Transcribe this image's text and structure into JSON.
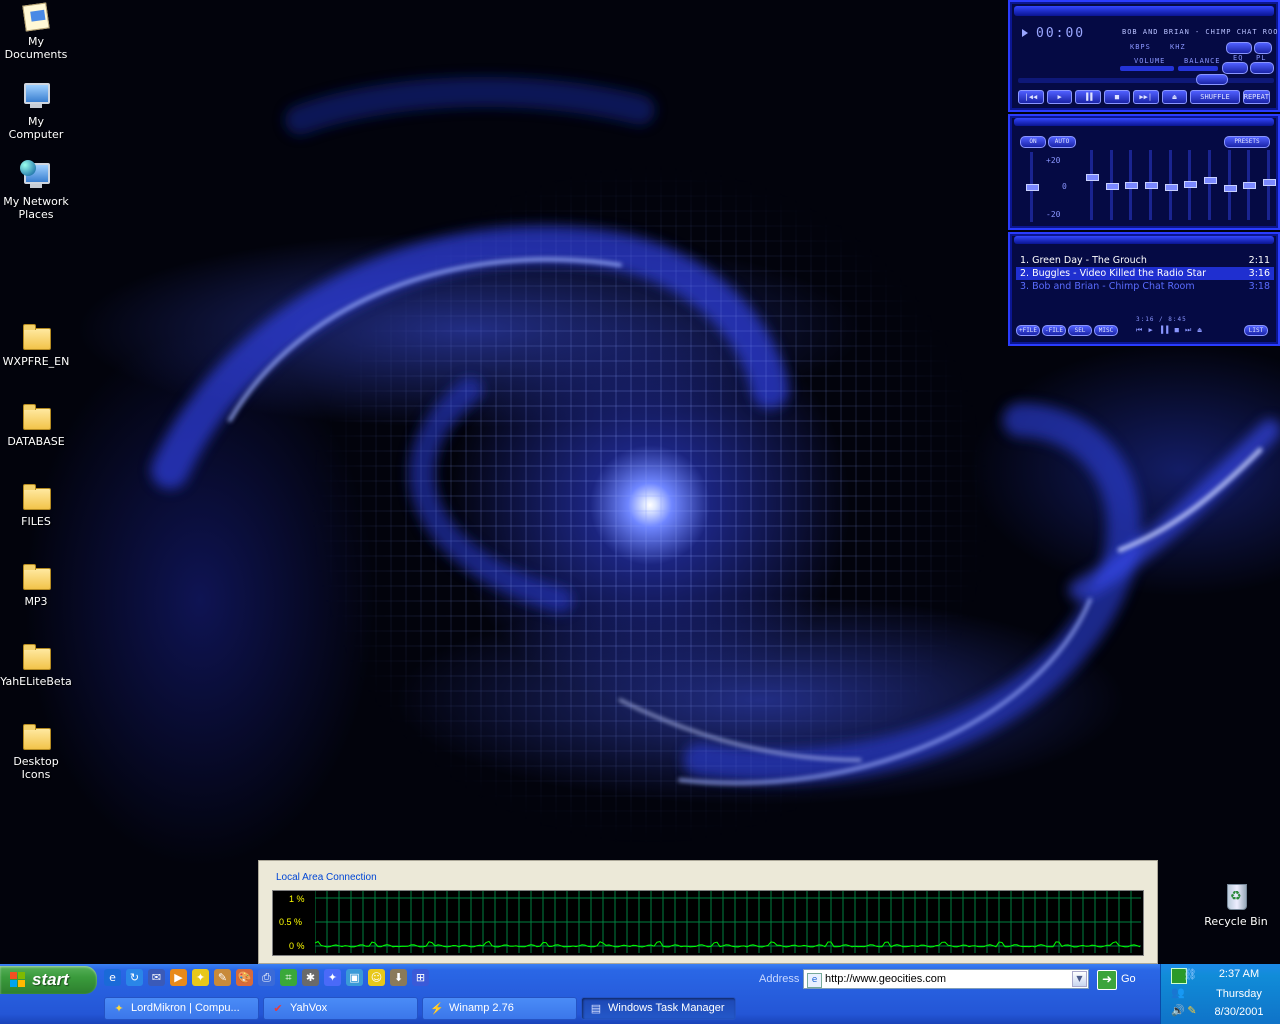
{
  "desktop": {
    "icons_left": [
      {
        "label": "My Documents",
        "icon": "my-documents-icon"
      },
      {
        "label": "My Computer",
        "icon": "my-computer-icon"
      },
      {
        "label": "My Network\nPlaces",
        "icon": "network-places-icon"
      },
      {
        "label": "WXPFRE_EN",
        "icon": "folder-icon"
      },
      {
        "label": "DATABASE",
        "icon": "folder-icon"
      },
      {
        "label": "FILES",
        "icon": "folder-icon"
      },
      {
        "label": "MP3",
        "icon": "folder-icon"
      },
      {
        "label": "YahELiteBeta",
        "icon": "folder-icon"
      },
      {
        "label": "Desktop Icons",
        "icon": "folder-icon"
      }
    ],
    "recycle_bin": {
      "label": "Recycle Bin",
      "icon": "recycle-bin-icon"
    }
  },
  "winamp": {
    "time": "00:00",
    "song_scroll": "BOB AND BRIAN - CHIMP CHAT ROO",
    "kbps_label": "KBPS",
    "khz_label": "KHZ",
    "volume_label": "VOLUME",
    "balance_label": "BALANCE",
    "eq_label": "EQ",
    "pl_label": "PL",
    "transport": [
      "|◀◀",
      "▶",
      "▐▐",
      "■",
      "▶▶|",
      "⏏",
      "SHUFFLE",
      "REPEAT"
    ],
    "eq": {
      "on_label": "ON",
      "auto_label": "AUTO",
      "presets_label": "PRESETS",
      "scale_top": "+20",
      "scale_mid": "0",
      "scale_bottom": "-20",
      "preamp": 0.5,
      "bands": [
        0.62,
        0.48,
        0.5,
        0.5,
        0.47,
        0.52,
        0.58,
        0.46,
        0.5,
        0.55
      ]
    },
    "playlist": {
      "items": [
        {
          "title": "1. Green Day - The Grouch",
          "length": "2:11",
          "state": "normal"
        },
        {
          "title": "2. Buggles - Video Killed the Radio Star",
          "length": "3:16",
          "state": "selected"
        },
        {
          "title": "3. Bob and Brian - Chimp Chat Room",
          "length": "3:18",
          "state": "dim"
        }
      ],
      "buttons": [
        "+FILE",
        "-FILE",
        "SEL",
        "MISC"
      ],
      "total": "3:16 / 8:45",
      "list_button": "LIST"
    }
  },
  "network_monitor": {
    "title": "Local Area Connection",
    "y_labels": [
      "1 %",
      "0.5 %",
      "0 %"
    ],
    "line_color": "#00ff00",
    "grid_color": "#008040"
  },
  "taskbar": {
    "start_label": "start",
    "quick_launch": [
      "ie-icon",
      "refresh-icon",
      "outlook-icon",
      "media-player-icon",
      "yahoo-icon",
      "pencil-icon",
      "paint-icon",
      "printer-icon",
      "network-icon",
      "script-icon",
      "yahoo-messenger-icon",
      "window-icon",
      "smiley-icon",
      "install-icon",
      "windows-update-icon"
    ],
    "address_label": "Address",
    "address_value": "http://www.geocities.com",
    "go_label": "Go",
    "tasks": [
      {
        "label": "LordMikron  |  Compu...",
        "icon": "yahoo-icon",
        "active": false
      },
      {
        "label": "YahVox",
        "icon": "yahvox-icon",
        "active": false
      },
      {
        "label": "Winamp 2.76",
        "icon": "winamp-icon",
        "active": false
      },
      {
        "label": "Windows Task Manager",
        "icon": "task-manager-icon",
        "active": true
      }
    ],
    "clock_time": "2:37 AM",
    "clock_day": "Thursday",
    "clock_date": "8/30/2001"
  }
}
